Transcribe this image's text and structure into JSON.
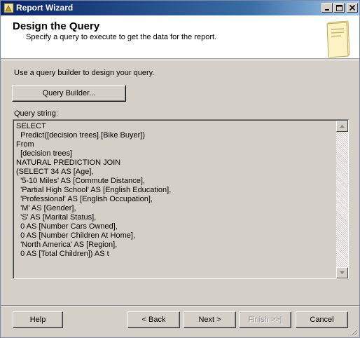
{
  "window": {
    "title": "Report Wizard"
  },
  "header": {
    "title": "Design the Query",
    "subtitle": "Specify a query to execute to get the data for the report."
  },
  "body": {
    "intro": "Use a query builder to design your query.",
    "query_builder_label": "Query Builder...",
    "query_string_label": "Query string:",
    "query_lines": [
      "SELECT",
      "  Predict([decision trees].[Bike Buyer])",
      "From",
      "  [decision trees]",
      "NATURAL PREDICTION JOIN",
      "(SELECT 34 AS [Age],",
      "  '5-10 Miles' AS [Commute Distance],",
      "  'Partial High School' AS [English Education],",
      "  'Professional' AS [English Occupation],",
      "  'M' AS [Gender],",
      "  'S' AS [Marital Status],",
      "  0 AS [Number Cars Owned],",
      "  0 AS [Number Children At Home],",
      "  'North America' AS [Region],",
      "  0 AS [Total Children]) AS t"
    ]
  },
  "footer": {
    "help": "Help",
    "back": "< Back",
    "next": "Next >",
    "finish": "Finish >>|",
    "cancel": "Cancel"
  }
}
